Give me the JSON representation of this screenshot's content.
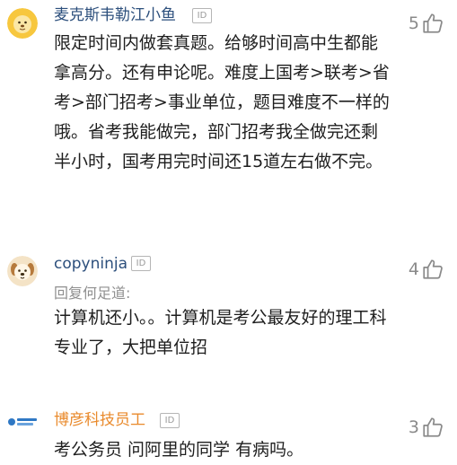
{
  "comments": [
    {
      "username": "麦克斯韦勒江小鱼",
      "id_badge": "ID",
      "avatar": "lion-cartoon-avatar",
      "likes": "5",
      "text": "限定时间内做套真题。给够时间高中生都能拿高分。还有申论呢。难度上国考>联考>省考>部门招考>事业单位，题目难度不一样的哦。省考我能做完，部门招考我全做完还剩半小时，国考用完时间还15道左右做不完。"
    },
    {
      "username": "copyninja",
      "id_badge": "ID",
      "avatar": "dog-cartoon-avatar",
      "likes": "4",
      "reply_hint": "回复何足道:",
      "text": "计算机还小。。计算机是考公最友好的理工科专业了，大把单位招"
    },
    {
      "username": "博彦科技员工",
      "id_badge": "ID",
      "avatar": "company-logo-avatar",
      "likes": "3",
      "text": "考公务员 问阿里的同学 有病吗。"
    }
  ],
  "icons": {
    "like": "thumbs-up-icon"
  },
  "colors": {
    "username": "#2c4f7c",
    "vip_username": "#e98a2c",
    "muted": "#8a8a8a",
    "text": "#1e1e1e"
  }
}
